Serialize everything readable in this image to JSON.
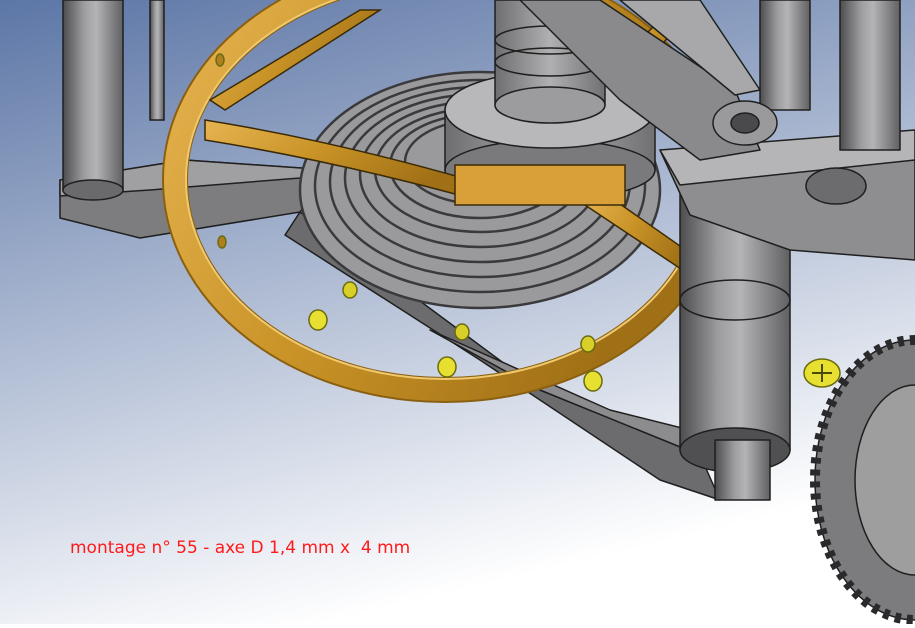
{
  "scene": {
    "caption": "montage n° 55 - axe D 1,4 mm x  4 mm",
    "colors": {
      "background_top": "#5c76a6",
      "background_bottom": "#ffffff",
      "steel_light": "#a9a9ab",
      "steel_mid": "#8a8a8c",
      "steel_dark": "#5a5a5c",
      "brass": "#c99327",
      "brass_light": "#e6b452",
      "screw_yellow": "#e8e030",
      "caption": "#ff1a1a"
    }
  }
}
